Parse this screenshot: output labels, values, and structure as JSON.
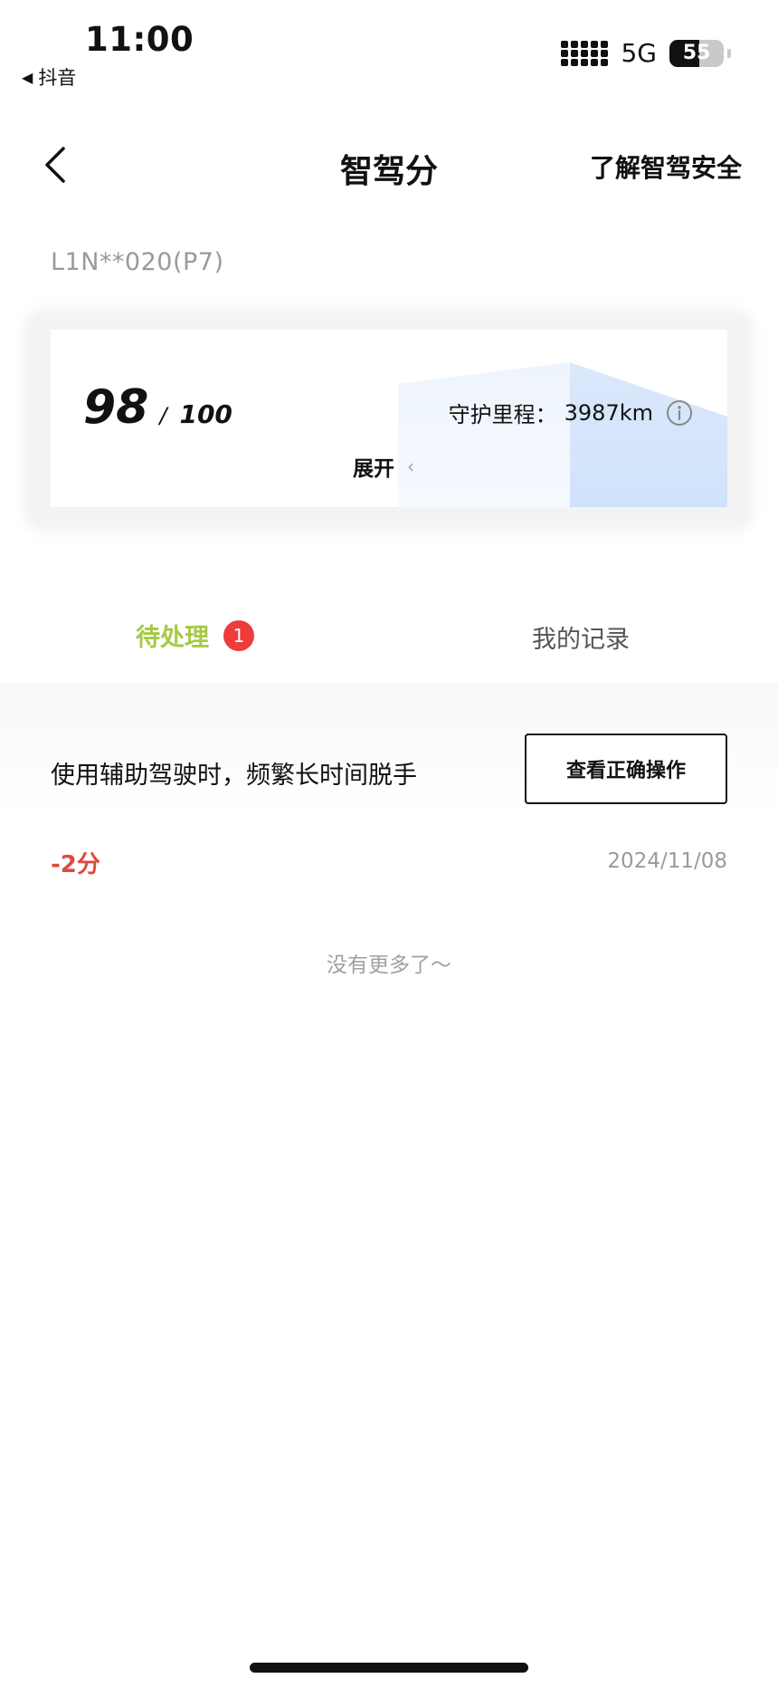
{
  "status_bar": {
    "time": "11:00",
    "back_app": "抖音",
    "network": "5G",
    "battery": "55"
  },
  "nav": {
    "title": "智驾分",
    "right_link": "了解智驾安全"
  },
  "vehicle_id": "L1N**020(P7)",
  "score_card": {
    "score": "98",
    "separator": "/",
    "max": "100",
    "mileage_label": "守护里程：",
    "mileage_value": "3987km",
    "expand_label": "展开",
    "expand_chevron": "‹"
  },
  "tabs": {
    "pending_label": "待处理",
    "pending_badge": "1",
    "records_label": "我的记录",
    "active_color": "#a6c945"
  },
  "items": [
    {
      "text": "使用辅助驾驶时，频繁长时间脱手",
      "button_label": "查看正确操作",
      "points": "-2分",
      "date": "2024/11/08"
    }
  ],
  "end_text": "没有更多了～",
  "colors": {
    "accent_green": "#a6c945",
    "badge_red": "#ee3b3b",
    "points_red": "#e0483e"
  },
  "icons": [
    "back-arrow-icon",
    "info-icon",
    "signal-icon",
    "battery-icon"
  ]
}
